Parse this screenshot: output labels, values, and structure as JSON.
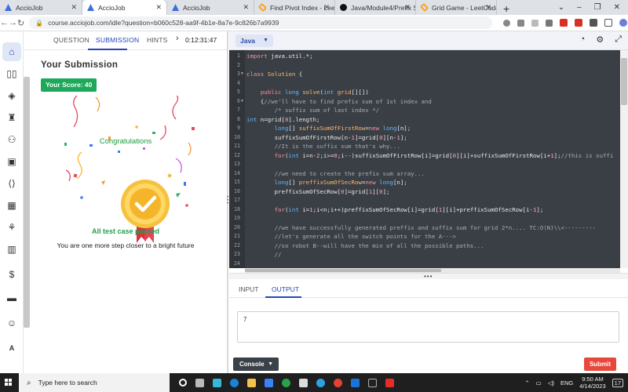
{
  "browser": {
    "tabs": [
      {
        "label": "AccioJob",
        "icon": "acciojob-favicon",
        "active": false
      },
      {
        "label": "AccioJob",
        "icon": "acciojob-favicon",
        "active": true
      },
      {
        "label": "AccioJob",
        "icon": "acciojob-favicon",
        "active": false
      },
      {
        "label": "Find Pivot Index - LeetC",
        "icon": "leetcode-favicon",
        "active": false
      },
      {
        "label": "Java/Module4/Prefix Su",
        "icon": "github-favicon",
        "active": false
      },
      {
        "label": "Grid Game - LeetCode",
        "icon": "leetcode-favicon",
        "active": false
      }
    ],
    "url": "course.acciojob.com/idle?question=b060c528-aa9f-4b1e-8a7e-9c826b7a9939"
  },
  "question_panel": {
    "tabs": [
      "QUESTION",
      "SUBMISSION",
      "HINTS"
    ],
    "active_tab": "SUBMISSION",
    "more_arrow": "›",
    "timer": "0:12:31:47",
    "heading": "Your Submission",
    "score": "Your Score: 40",
    "congrats": "Congratulations",
    "status": "All test case passed",
    "message": "You are one more step closer to a bright future"
  },
  "editor": {
    "language": "Java",
    "icons": [
      "timer-reset-icon",
      "settings-icon",
      "expand-icon"
    ],
    "lines": [
      {
        "n": 1,
        "html": "<span class='k'>import</span> java.util.*;"
      },
      {
        "n": 2,
        "html": ""
      },
      {
        "n": 3,
        "html": "<span class='k'>class</span> <span class='f'>Solution</span> {",
        "fold": true
      },
      {
        "n": 4,
        "html": ""
      },
      {
        "n": 5,
        "html": "    <span class='k'>public</span> <span class='t'>long</span> <span class='f'>solve</span>(<span class='t'>int</span> <span class='f'>grid</span>[][])",
        "fold": false
      },
      {
        "n": 6,
        "html": "    {<span class='c'>//we'll have to find prefix sum of 1st index and</span>",
        "fold": true
      },
      {
        "n": 7,
        "html": "        <span class='c'>/* suffix sum of last index */</span>"
      },
      {
        "n": 8,
        "html": "<span class='t'>int</span> n=grid[<span class='n'>0</span>].length;",
        "outdent": true
      },
      {
        "n": 9,
        "html": "        <span class='t'>long</span>[] <span class='f'>suffixSumOfFirstRow</span>=<span class='k'>new</span> <span class='t'>long</span>[n];"
      },
      {
        "n": 10,
        "html": "        suffixSumOfFirstRow[n-<span class='n'>1</span>]=grid[<span class='n'>0</span>][n-<span class='n'>1</span>];"
      },
      {
        "n": 11,
        "html": "        <span class='c'>//It is the suffix sum that's why...</span>"
      },
      {
        "n": 12,
        "html": "        <span class='k'>for</span>(<span class='t'>int</span> i=n-<span class='n'>2</span>;i>=<span class='n'>0</span>;i--)suffixSumOfFirstRow[i]=grid[<span class='n'>0</span>][i]+suffixSumOfFirstRow[i+<span class='n'>1</span>];<span class='c'>//this is suffi</span>"
      },
      {
        "n": 13,
        "html": ""
      },
      {
        "n": 14,
        "html": "        <span class='c'>//we need to create the prefix sum array...</span>"
      },
      {
        "n": 15,
        "html": "        <span class='t'>long</span>[] <span class='f'>preffixSumOfSecRow</span>=<span class='k'>new</span> <span class='t'>long</span>[n];"
      },
      {
        "n": 16,
        "html": "        preffixSumOfSecRow[<span class='n'>0</span>]=grid[<span class='n'>1</span>][<span class='n'>0</span>];"
      },
      {
        "n": 17,
        "html": ""
      },
      {
        "n": 18,
        "html": "        <span class='k'>for</span>(<span class='t'>int</span> i=<span class='n'>1</span>;i&lt;n;i++)preffixSumOfSecRow[i]=grid[<span class='n'>1</span>][i]+preffixSumOfSecRow[i-<span class='n'>1</span>];"
      },
      {
        "n": 19,
        "html": ""
      },
      {
        "n": 20,
        "html": "        <span class='c'>//we have successfully generated preffix and suffix sum for grid 2*n.... TC:O(N)\\\\&lt;---------</span>"
      },
      {
        "n": 21,
        "html": "        <span class='c'>//let's generate all the switch points for the A---&gt;</span>"
      },
      {
        "n": 22,
        "html": "        <span class='c'>//so robot B--will have the min of all the possible paths...</span>"
      },
      {
        "n": 23,
        "html": "        <span class='c'>//</span>"
      },
      {
        "n": 24,
        "html": ""
      }
    ]
  },
  "io": {
    "tabs": [
      "INPUT",
      "OUTPUT"
    ],
    "active_tab": "OUTPUT",
    "output_value": "7",
    "console_label": "Console",
    "submit_label": "Submit"
  },
  "taskbar": {
    "search_placeholder": "Type here to search",
    "language": "ENG",
    "time": "9:50 AM",
    "date": "4/14/2023",
    "notification_count": "17"
  },
  "colors": {
    "accent": "#2646b8",
    "score_green": "#1ea85a",
    "submit_red": "#e8483b",
    "editor_bg": "#3a3f45"
  }
}
